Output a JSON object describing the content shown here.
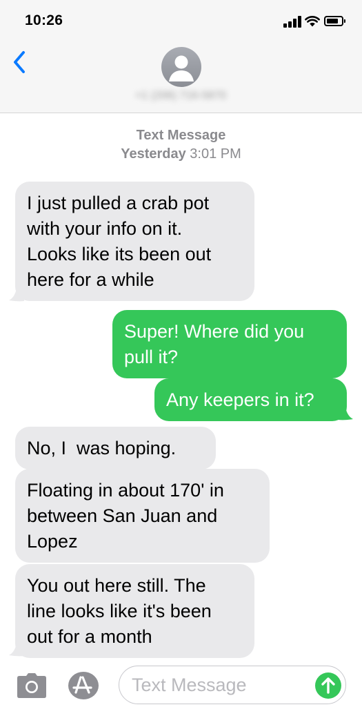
{
  "status": {
    "time": "10:26"
  },
  "header": {
    "contact": "+1 (206) 716-5870"
  },
  "thread": {
    "service": "Text Message",
    "day": "Yesterday",
    "time": "3:01 PM"
  },
  "messages": [
    {
      "dir": "in",
      "lines": [
        "I just pulled a crab pot",
        "with your info on it.",
        "Looks like its been out",
        "here for a while"
      ]
    },
    {
      "dir": "out",
      "lines": [
        "Super! Where did you",
        "pull it?"
      ]
    },
    {
      "dir": "out",
      "lines": [
        "Any keepers in it?"
      ]
    },
    {
      "dir": "in",
      "lines": [
        "No, I  was hoping."
      ]
    },
    {
      "dir": "in",
      "lines": [
        "Floating in about 170' in",
        "between San Juan and",
        "Lopez"
      ]
    },
    {
      "dir": "in",
      "lines": [
        "You out here still. The",
        "line looks like it's been",
        "out for a month"
      ]
    }
  ],
  "input": {
    "placeholder": "Text Message"
  },
  "colors": {
    "outgoing": "#35c759",
    "incoming": "#e9e9eb",
    "accent": "#0a7aff"
  },
  "icons": [
    "back-chevron-icon",
    "contact-avatar-icon",
    "camera-icon",
    "app-store-icon",
    "send-arrow-icon"
  ]
}
